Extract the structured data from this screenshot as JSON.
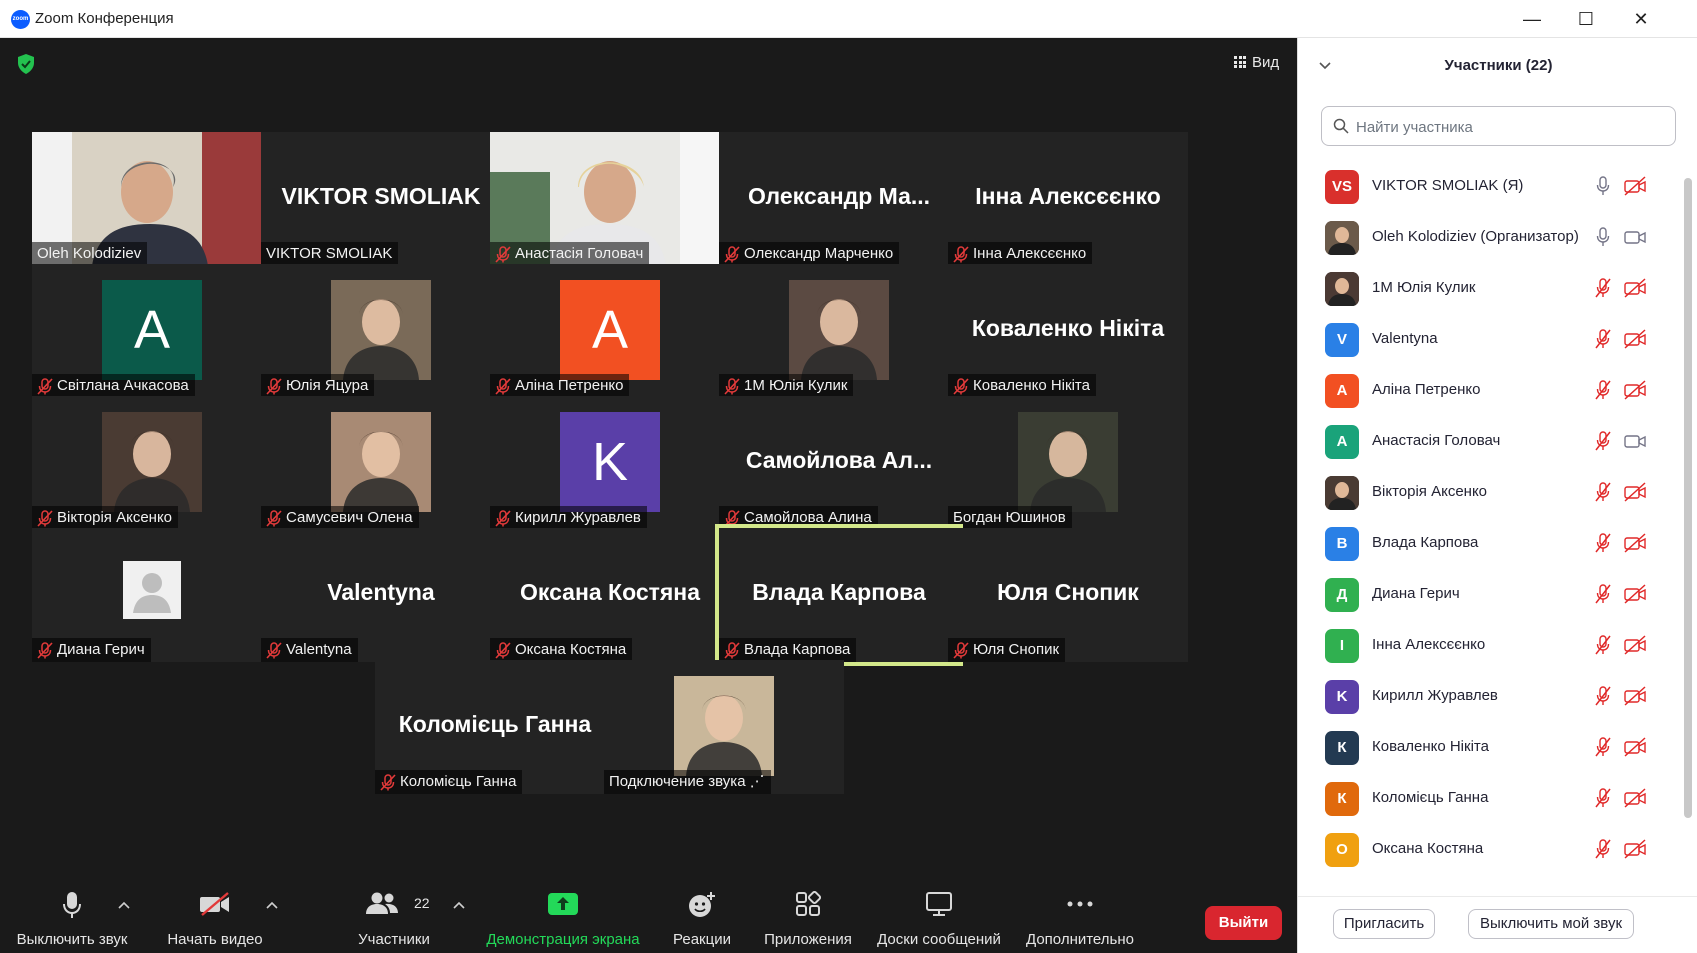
{
  "window": {
    "title": "Zoom Конференция",
    "logo_text": "zoom",
    "minimize": "—",
    "maximize": "☐",
    "close": "✕"
  },
  "video_area": {
    "view_label": "Вид",
    "tiles": [
      {
        "name": "Oleh Kolodiziev",
        "muted": false,
        "kind": "video"
      },
      {
        "name": "VIKTOR SMOLIAK",
        "muted": false,
        "kind": "name",
        "big": "VIKTOR SMOLIAK"
      },
      {
        "name": "Анастасія Головач",
        "muted": true,
        "kind": "video2"
      },
      {
        "name": "Олександр Марченко",
        "muted": true,
        "kind": "name",
        "big": "Олександр  Ма..."
      },
      {
        "name": "Інна Алексєєнко",
        "muted": true,
        "kind": "name",
        "big": "Інна Алексєєнко"
      },
      {
        "name": "Світлана Ачкасова",
        "muted": true,
        "kind": "letter",
        "letter": "A",
        "color": "#0b5a4a"
      },
      {
        "name": "Юлія Яцура",
        "muted": true,
        "kind": "photo",
        "color": "#7a6a58"
      },
      {
        "name": "Аліна Петренко",
        "muted": true,
        "kind": "letter",
        "letter": "A",
        "color": "#f25022"
      },
      {
        "name": "1М Юлія Кулик",
        "muted": true,
        "kind": "photo",
        "color": "#5b4a42"
      },
      {
        "name": "Коваленко Нікіта",
        "muted": true,
        "kind": "name",
        "big": "Коваленко Нікіта"
      },
      {
        "name": "Вікторія Аксенко",
        "muted": true,
        "kind": "photo",
        "color": "#4a3b33"
      },
      {
        "name": "Самусевич Олена",
        "muted": true,
        "kind": "photo",
        "color": "#a88a74"
      },
      {
        "name": "Кирилл Журавлев",
        "muted": true,
        "kind": "letter",
        "letter": "K",
        "color": "#5a3fa8"
      },
      {
        "name": "Самойлова Алина",
        "muted": true,
        "kind": "name",
        "big": "Самойлова  Ал..."
      },
      {
        "name": "Богдан Юшинов",
        "muted": false,
        "kind": "photo",
        "color": "#3a3d33"
      },
      {
        "name": "Диана Герич",
        "muted": true,
        "kind": "silhouette"
      },
      {
        "name": "Valentyna",
        "muted": true,
        "kind": "name",
        "big": "Valentyna"
      },
      {
        "name": "Оксана Костяна",
        "muted": true,
        "kind": "name",
        "big": "Оксана Костяна"
      },
      {
        "name": "Влада Карпова",
        "muted": true,
        "kind": "name",
        "big": "Влада Карпова",
        "active": true
      },
      {
        "name": "Юля Снопик",
        "muted": true,
        "kind": "name",
        "big": "Юля Снопик"
      },
      {
        "name": "Коломієць Ганна",
        "muted": true,
        "kind": "name",
        "big": "Коломієць Ганна"
      },
      {
        "name": "Подключение звука ⋰",
        "muted": false,
        "kind": "photo",
        "color": "#c9b79a"
      }
    ]
  },
  "toolbar": {
    "mute": "Выключить звук",
    "video": "Начать видео",
    "participants": "Участники",
    "participants_count": "22",
    "share": "Демонстрация экрана",
    "reactions": "Реакции",
    "apps": "Приложения",
    "whiteboards": "Доски сообщений",
    "more": "Дополнительно",
    "leave": "Выйти",
    "share_color": "#23d959",
    "leave_color": "#d9262f"
  },
  "panel": {
    "title": "Участники (22)",
    "search_placeholder": "Найти участника",
    "participants": [
      {
        "name": "VIKTOR SMOLIAK (Я)",
        "initials": "VS",
        "color": "#d9302c",
        "mic": "on",
        "cam": "off"
      },
      {
        "name": "Oleh Kolodiziev (Организатор)",
        "initials": "",
        "color": "#6b5a4a",
        "mic": "on",
        "cam": "on",
        "photo": true
      },
      {
        "name": "1М Юлія Кулик",
        "initials": "",
        "color": "#4b3a34",
        "mic": "muted",
        "cam": "off",
        "photo": true
      },
      {
        "name": "Valentyna",
        "initials": "V",
        "color": "#2a80e6",
        "mic": "muted",
        "cam": "off"
      },
      {
        "name": "Аліна Петренко",
        "initials": "А",
        "color": "#f25022",
        "mic": "muted",
        "cam": "off"
      },
      {
        "name": "Анастасія Головач",
        "initials": "А",
        "color": "#1aa37a",
        "mic": "muted",
        "cam": "on"
      },
      {
        "name": "Вікторія Аксенко",
        "initials": "",
        "color": "#4a3b33",
        "mic": "muted",
        "cam": "off",
        "photo": true
      },
      {
        "name": "Влада Карпова",
        "initials": "В",
        "color": "#2a80e6",
        "mic": "muted",
        "cam": "off"
      },
      {
        "name": "Диана Герич",
        "initials": "Д",
        "color": "#30b050",
        "mic": "muted",
        "cam": "off"
      },
      {
        "name": "Інна Алексєєнко",
        "initials": "І",
        "color": "#30b050",
        "mic": "muted",
        "cam": "off"
      },
      {
        "name": "Кирилл Журавлев",
        "initials": "K",
        "color": "#5a3fa8",
        "mic": "muted",
        "cam": "off"
      },
      {
        "name": "Коваленко Нікіта",
        "initials": "К",
        "color": "#233a52",
        "mic": "muted",
        "cam": "off"
      },
      {
        "name": "Коломієць Ганна",
        "initials": "К",
        "color": "#e0690c",
        "mic": "muted",
        "cam": "off"
      },
      {
        "name": "Оксана Костяна",
        "initials": "О",
        "color": "#f0a010",
        "mic": "muted",
        "cam": "off"
      },
      {
        "name": "",
        "initials": "",
        "color": "#c0392b",
        "mic": "muted",
        "cam": "off"
      }
    ],
    "invite": "Пригласить",
    "mute_me": "Выключить мой звук"
  }
}
